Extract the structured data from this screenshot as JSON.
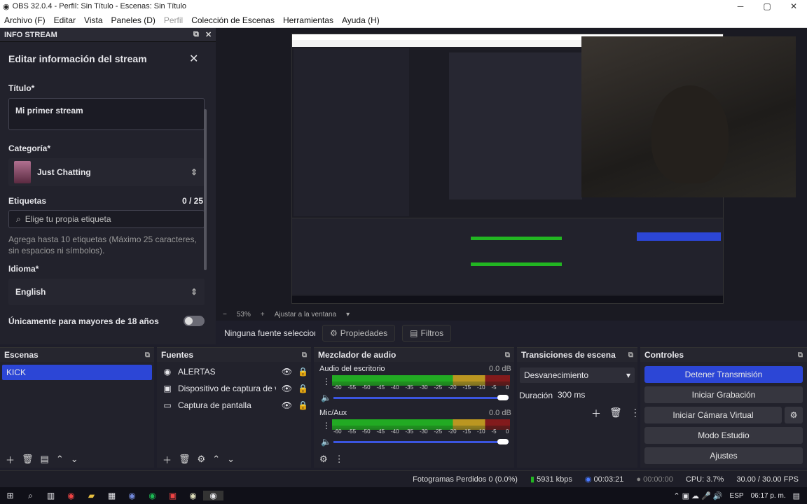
{
  "window": {
    "title": "OBS 32.0.4 - Perfil: Sin Título - Escenas: Sin Título"
  },
  "menu": [
    "Archivo (F)",
    "Editar",
    "Vista",
    "Paneles (D)",
    "Perfil",
    "Colección de Escenas",
    "Herramientas",
    "Ayuda (H)"
  ],
  "stream_dock": {
    "title": "INFO STREAM",
    "heading": "Editar información del stream",
    "title_label": "Título*",
    "title_value": "Mi primer stream",
    "category_label": "Categoría*",
    "category_value": "Just Chatting",
    "tags_label": "Etiquetas",
    "tags_count": "0 / 25",
    "tags_placeholder": "Elige tu propia etiqueta",
    "tags_help": "Agrega hasta 10 etiquetas (Máximo 25 caracteres, sin espacios ni símbolos).",
    "language_label": "Idioma*",
    "language_value": "English",
    "adult_label": "Únicamente para mayores de 18 años"
  },
  "preview": {
    "zoom": "53%",
    "fit_label": "Ajustar a la ventana"
  },
  "source_bar": {
    "none_selected": "Ninguna fuente seleccionada",
    "properties": "Propiedades",
    "filters": "Filtros"
  },
  "scenes": {
    "title": "Escenas",
    "items": [
      "KICK"
    ]
  },
  "sources": {
    "title": "Fuentes",
    "items": [
      "ALERTAS",
      "Dispositivo de captura de video",
      "Captura de pantalla"
    ]
  },
  "mixer": {
    "title": "Mezclador de audio",
    "channels": [
      {
        "name": "Audio del escritorio",
        "db": "0.0 dB"
      },
      {
        "name": "Mic/Aux",
        "db": "0.0 dB"
      }
    ],
    "scale": [
      "-60",
      "-55",
      "-50",
      "-45",
      "-40",
      "-35",
      "-30",
      "-25",
      "-20",
      "-15",
      "-10",
      "-5",
      "0"
    ]
  },
  "transitions": {
    "title": "Transiciones de escena",
    "type": "Desvanecimiento",
    "duration_label": "Duración",
    "duration_value": "300 ms"
  },
  "controls": {
    "title": "Controles",
    "stop_stream": "Detener Transmisión",
    "start_recording": "Iniciar Grabación",
    "virtual_cam": "Iniciar Cámara Virtual",
    "studio_mode": "Modo Estudio",
    "settings": "Ajustes"
  },
  "status": {
    "dropped": "Fotogramas Perdidos 0 (0.0%)",
    "bitrate": "5931 kbps",
    "stream_time": "00:03:21",
    "rec_time": "00:00:00",
    "cpu": "CPU: 3.7%",
    "fps": "30.00 / 30.00 FPS"
  },
  "taskbar": {
    "lang": "ESP",
    "time": "06:17 p. m."
  },
  "colors": {
    "accent": "#2c46d6",
    "bg": "#1e1e2a",
    "meter_green": "#22b622"
  }
}
